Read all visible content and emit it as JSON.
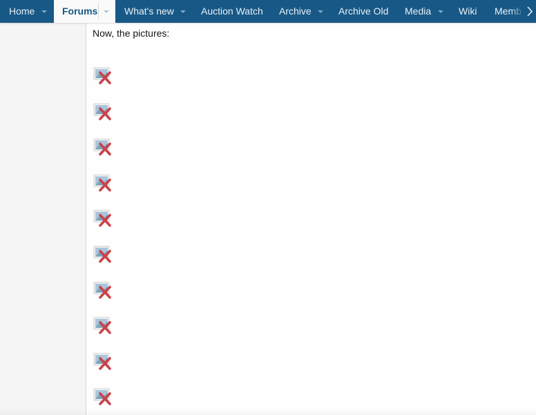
{
  "nav": {
    "items": [
      {
        "label": "Home",
        "has_dropdown": true,
        "selected": false
      },
      {
        "label": "Forums",
        "has_dropdown": true,
        "selected": true
      },
      {
        "label": "What's new",
        "has_dropdown": true,
        "selected": false
      },
      {
        "label": "Auction Watch",
        "has_dropdown": false,
        "selected": false
      },
      {
        "label": "Archive",
        "has_dropdown": true,
        "selected": false
      },
      {
        "label": "Archive Old",
        "has_dropdown": false,
        "selected": false
      },
      {
        "label": "Media",
        "has_dropdown": true,
        "selected": false
      },
      {
        "label": "Wiki",
        "has_dropdown": false,
        "selected": false
      },
      {
        "label": "Memb",
        "has_dropdown": false,
        "selected": false
      }
    ],
    "scroll_icon": "chevron-right-icon"
  },
  "content": {
    "intro_text": "Now, the pictures:",
    "broken_image_icon": "broken-image-icon",
    "image_count": 10
  },
  "colors": {
    "nav_bg": "#185886",
    "nav_text": "#e9f0f6",
    "selected_tab_bg": "#fafafa",
    "selected_tab_text": "#185886",
    "sidebar_bg": "#f5f5f5",
    "x_red": "#c9424a"
  }
}
